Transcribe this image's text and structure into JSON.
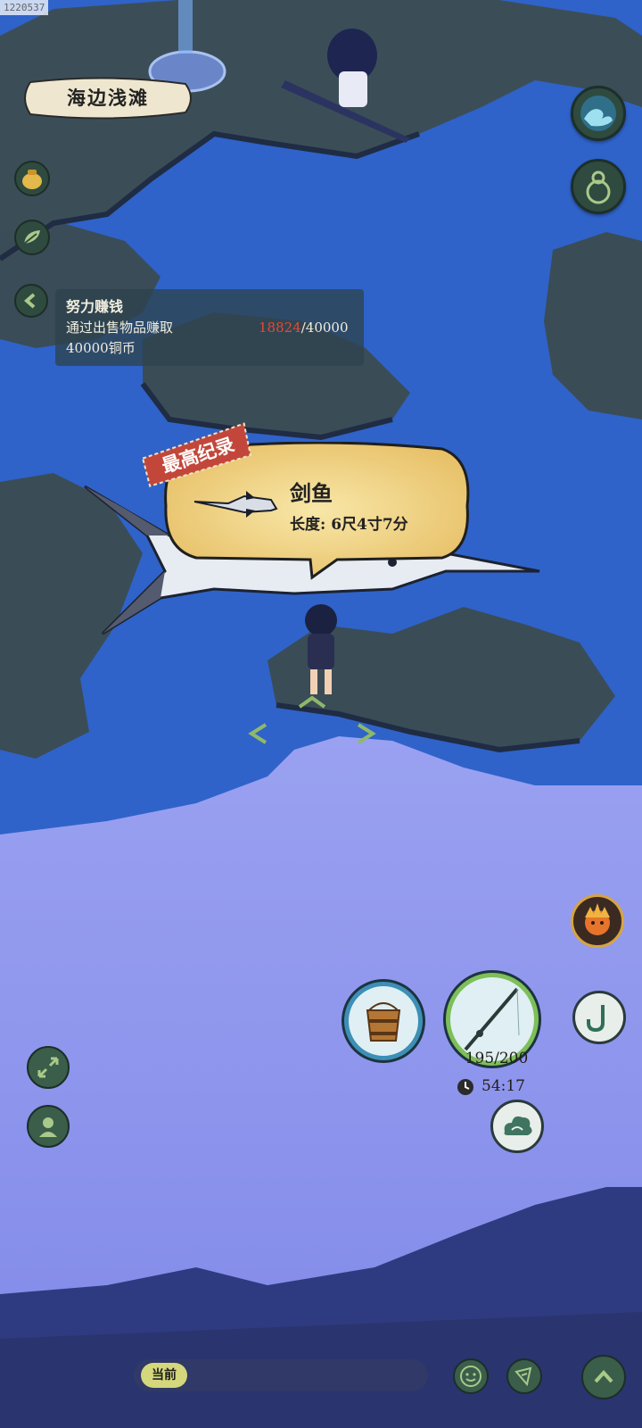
{
  "build_id": "1220537",
  "location": {
    "name": "海边浅滩"
  },
  "quest": {
    "title": "努力赚钱",
    "description_line1": "通过出售物品赚取",
    "description_line2": "40000铜币",
    "progress_current": "18824",
    "progress_target": "/40000",
    "progress_fraction": 0.4706
  },
  "catch": {
    "badge": "最高纪录",
    "fish_name": "剑鱼",
    "length": "长度: 6尺4寸7分"
  },
  "rod": {
    "durability": "195/200",
    "durability_fraction": 0.975
  },
  "timer": {
    "value": "54:17"
  },
  "chat": {
    "channel_label": "当前"
  },
  "icons": {
    "wave": "wave-skill-icon",
    "gourd": "gourd-icon",
    "pouch": "coin-pouch-icon",
    "leaf": "leaf-icon",
    "back": "collapse-arrow-icon",
    "fire_head": "fire-spirit-icon",
    "bucket": "fish-bucket-icon",
    "rod": "fishing-rod-icon",
    "hook": "hook-icon",
    "cloud": "cloud-skill-icon",
    "expand": "expand-icon",
    "character": "character-icon",
    "emoji": "emoji-icon",
    "voice": "voice-icon",
    "up": "up-arrow-icon"
  },
  "colors": {
    "sea": "#2f63c9",
    "fog": "#8f98ef",
    "island": "#3b4e58",
    "progress_highlight": "#e24a3a",
    "parchment": "#f0d88f"
  }
}
